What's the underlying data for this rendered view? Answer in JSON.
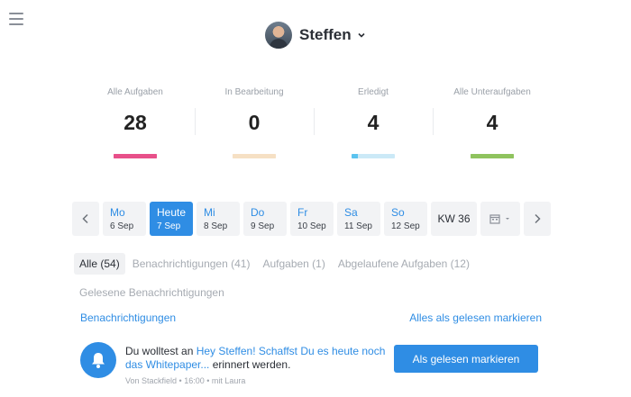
{
  "header": {
    "user_name": "Steffen"
  },
  "stats": [
    {
      "label": "Alle Aufgaben",
      "value": "28",
      "color": "#e8508a",
      "fill": 1.0
    },
    {
      "label": "In Bearbeitung",
      "value": "0",
      "color": "#f6e0c4",
      "fill": 1.0
    },
    {
      "label": "Erledigt",
      "value": "4",
      "color": "#cbe9f7",
      "fill": 0.14,
      "fill_color": "#5bc3ef"
    },
    {
      "label": "Alle Unteraufgaben",
      "value": "4",
      "color": "#8fc35e",
      "fill": 1.0
    }
  ],
  "calendar": {
    "days": [
      {
        "name": "Mo",
        "date": "6 Sep"
      },
      {
        "name": "Heute",
        "date": "7 Sep",
        "active": true
      },
      {
        "name": "Mi",
        "date": "8 Sep"
      },
      {
        "name": "Do",
        "date": "9 Sep"
      },
      {
        "name": "Fr",
        "date": "10 Sep"
      },
      {
        "name": "Sa",
        "date": "11 Sep"
      },
      {
        "name": "So",
        "date": "12 Sep"
      }
    ],
    "week_label": "KW 36"
  },
  "filters": {
    "row1": [
      "Alle (54)",
      "Benachrichtigungen (41)",
      "Aufgaben (1)",
      "Abgelaufene Aufgaben (12)"
    ],
    "row2": [
      "Gelesene Benachrichtigungen"
    ]
  },
  "section": {
    "title": "Benachrichtigungen",
    "mark_all": "Alles als gelesen markieren"
  },
  "notification": {
    "prefix": "Du wolltest an ",
    "link": "Hey Steffen! Schaffst Du es heute noch das Whitepaper...",
    "suffix": " erinnert werden.",
    "meta": "Von Stackfield • 16:00 • mit Laura",
    "button": "Als gelesen markieren"
  },
  "colors": {
    "accent": "#2f8de4"
  }
}
